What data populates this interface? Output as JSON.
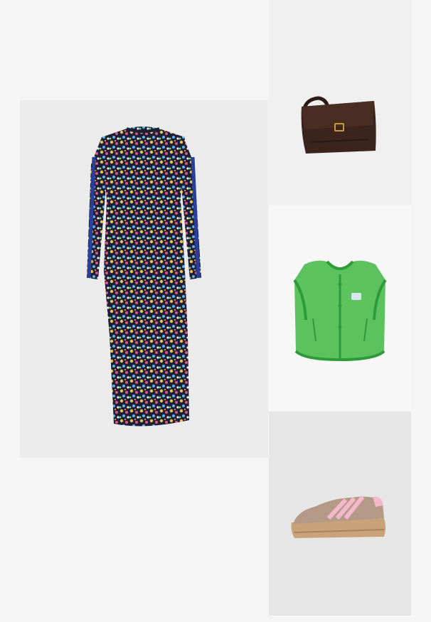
{
  "outfit": {
    "items": [
      {
        "id": "dress",
        "product": "floral-print-maxi-dress",
        "colors": {
          "base": "#1b1f3a",
          "stripe": "#2a3f9b",
          "accent": "#e8c446"
        }
      },
      {
        "id": "bag",
        "product": "brown-suede-crossbody-bag",
        "colors": {
          "body": "#3b241c",
          "buckle": "#c79a3e"
        }
      },
      {
        "id": "vest",
        "product": "green-fleece-vest",
        "colors": {
          "body": "#5cc25e",
          "trim": "#2f9a3a"
        }
      },
      {
        "id": "shoe",
        "product": "pink-stripe-platform-sneaker",
        "colors": {
          "upper": "#b49a86",
          "stripes": "#f3b8cc",
          "sole": "#c9a27a"
        }
      }
    ]
  }
}
